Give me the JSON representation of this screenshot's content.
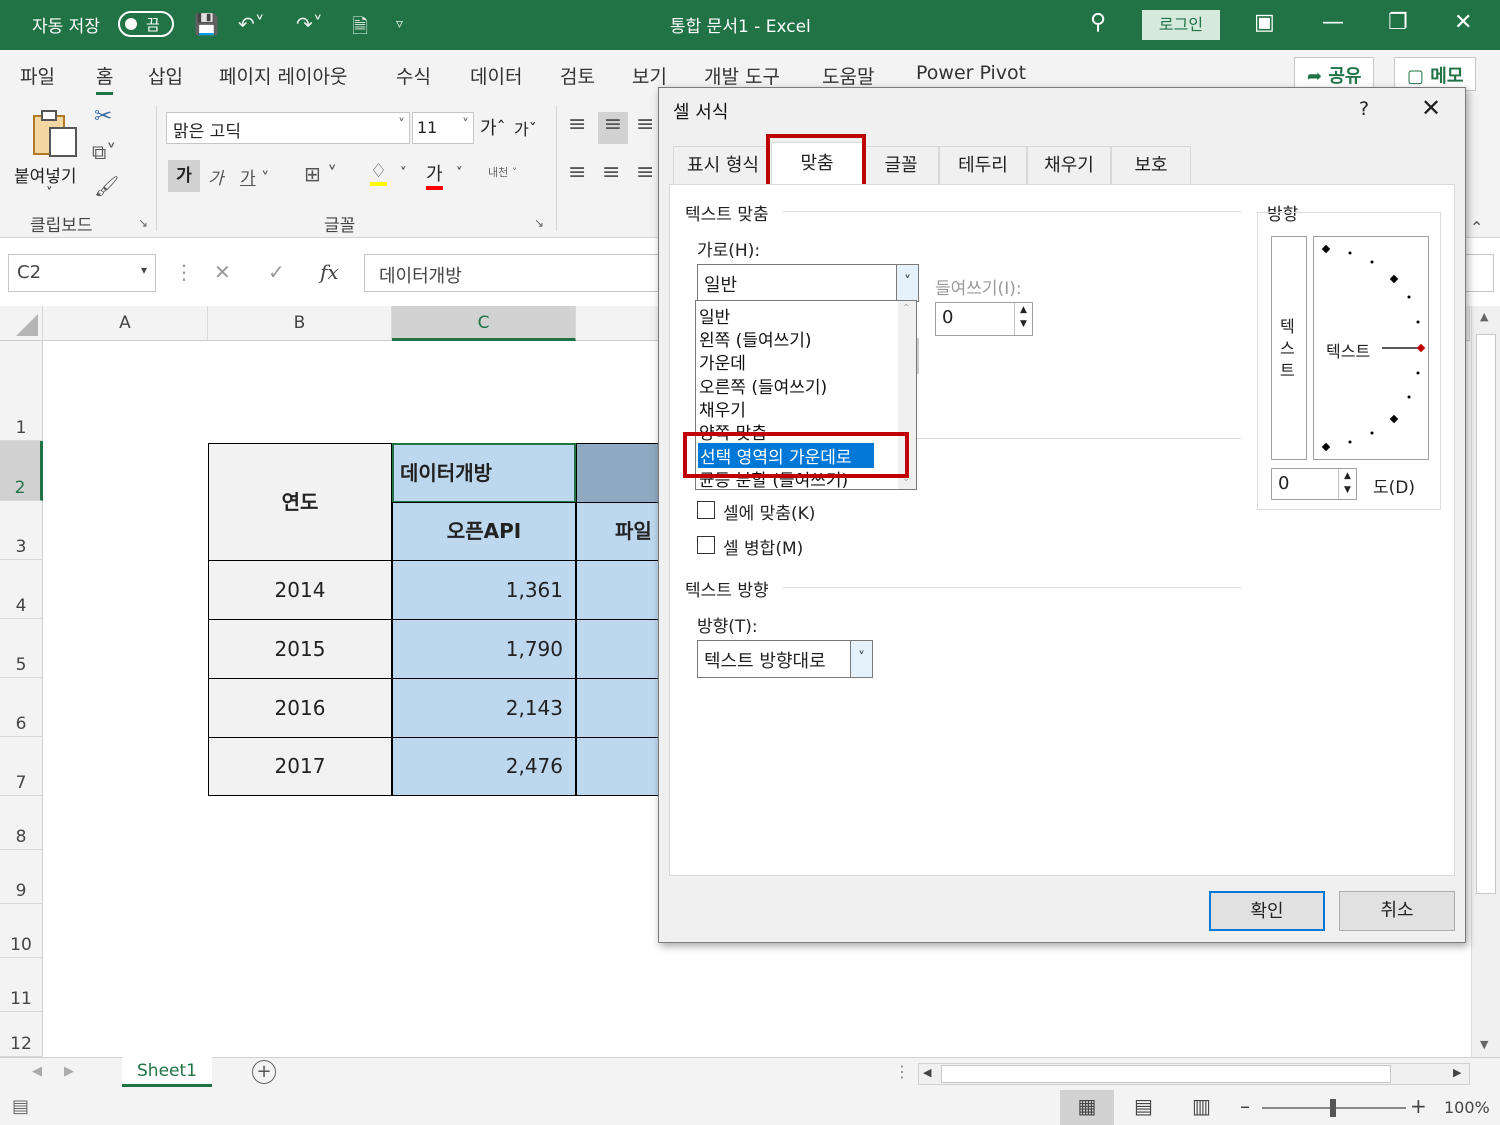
{
  "titlebar": {
    "autosave_label": "자동 저장",
    "autosave_state": "끔",
    "doc_title": "통합 문서1  -  Excel",
    "login": "로그인"
  },
  "ribbon_tabs": [
    "파일",
    "홈",
    "삽입",
    "페이지 레이아웃",
    "수식",
    "데이터",
    "검토",
    "보기",
    "개발 도구",
    "도움말",
    "Power Pivot"
  ],
  "ribbon": {
    "share": "공유",
    "memo": "메모",
    "paste_label": "붙여넣기",
    "clipboard_group": "클립보드",
    "font_group": "글꼴",
    "font_name": "맑은 고딕",
    "font_size": "11",
    "grow_font": "가",
    "shrink_font": "가",
    "bold": "가",
    "italic": "가",
    "underline": "가",
    "font_color": "가",
    "phonetic": "내천"
  },
  "formula_bar": {
    "name_box": "C2",
    "fx": "fx",
    "content": "데이터개방"
  },
  "grid": {
    "columns": [
      "A",
      "B",
      "C"
    ],
    "rows": [
      "1",
      "2",
      "3",
      "4",
      "5",
      "6",
      "7",
      "8",
      "9",
      "10",
      "11",
      "12"
    ],
    "table": {
      "year_header": "연도",
      "group_header": "데이터개방",
      "sub_header_1": "오픈API",
      "sub_header_2": "파일",
      "rows": [
        {
          "year": "2014",
          "api": "1,361"
        },
        {
          "year": "2015",
          "api": "1,790"
        },
        {
          "year": "2016",
          "api": "2,143"
        },
        {
          "year": "2017",
          "api": "2,476"
        }
      ]
    }
  },
  "sheet": {
    "tab": "Sheet1",
    "zoom": "100%"
  },
  "dialog": {
    "title": "셀 서식",
    "help": "?",
    "tabs": [
      "표시 형식",
      "맞춤",
      "글꼴",
      "테두리",
      "채우기",
      "보호"
    ],
    "section_text_align": "텍스트 맞춤",
    "horizontal_label": "가로(H):",
    "horizontal_value": "일반",
    "indent_label": "들여쓰기(I):",
    "indent_value": "0",
    "horizontal_options": [
      "일반",
      "왼쪽 (들여쓰기)",
      "가운데",
      "오른쪽 (들여쓰기)",
      "채우기",
      "양쪽 맞춤",
      "선택 영역의 가운데로",
      "균등 분할 (들여쓰기)"
    ],
    "selected_option": "선택 영역의 가운데로",
    "fit_cell": "셀에 맞춤(K)",
    "merge_cells": "셀 병합(M)",
    "section_text_direction": "텍스트 방향",
    "direction_label": "방향(T):",
    "direction_value": "텍스트 방향대로",
    "orientation_label": "방향",
    "vertical_text": [
      "텍",
      "스",
      "트"
    ],
    "orientation_text": "텍스트",
    "degrees_value": "0",
    "degrees_label": "도(D)",
    "ok": "확인",
    "cancel": "취소"
  },
  "colors": {
    "excel_green": "#217346",
    "highlight_red": "#c00000",
    "cell_blue": "#bdd7ee",
    "select_blue": "#0078d7"
  }
}
